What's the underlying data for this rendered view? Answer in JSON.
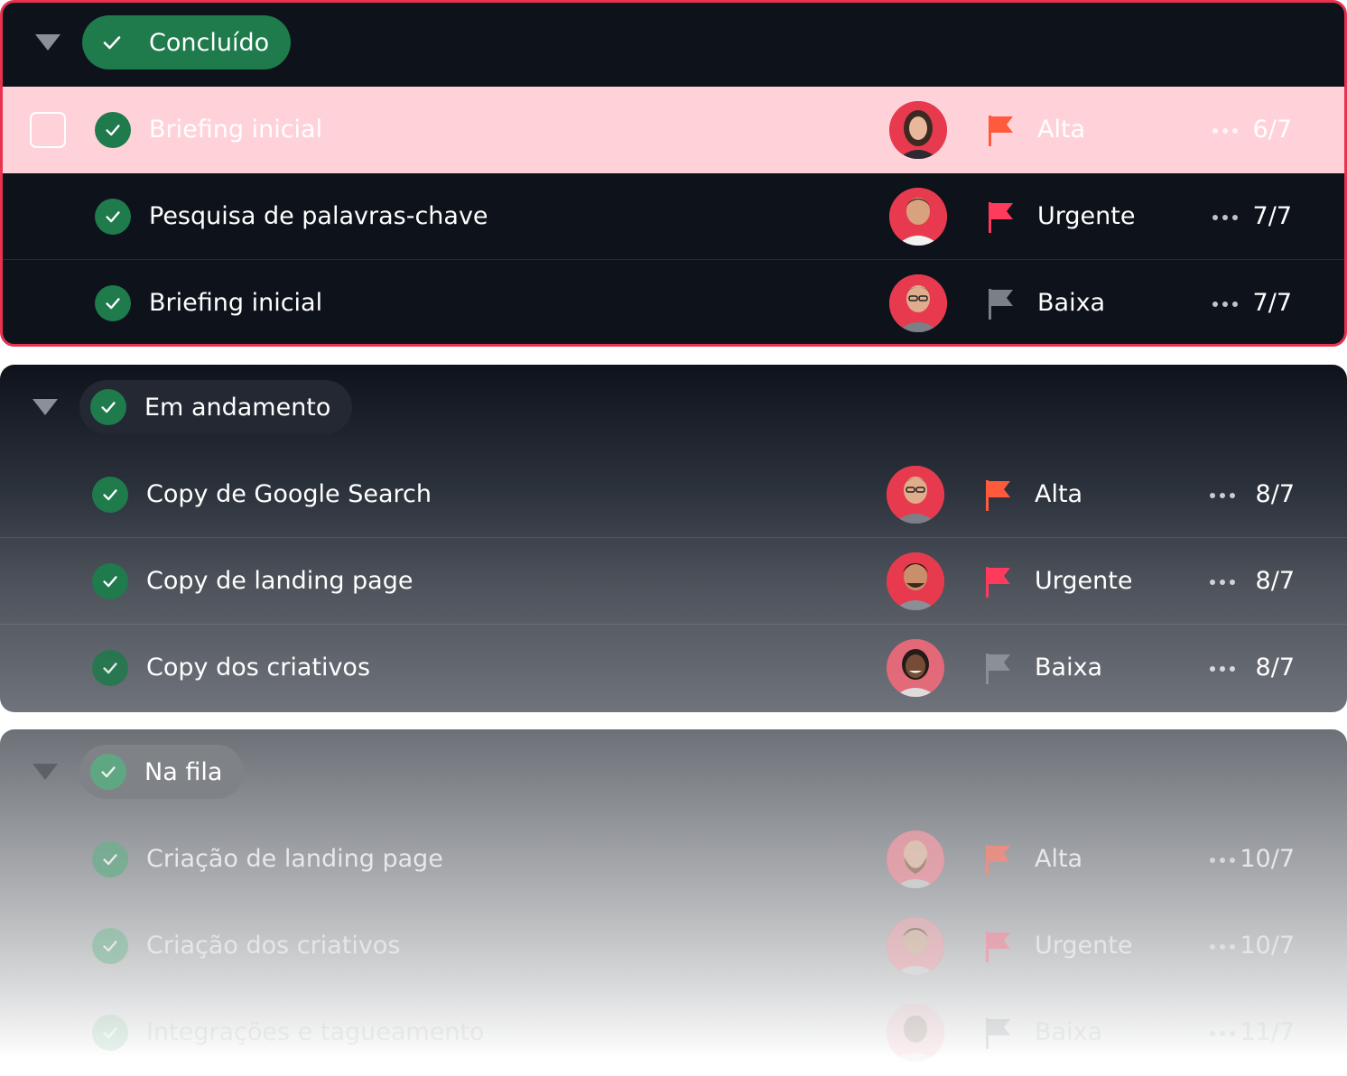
{
  "colors": {
    "accent_red": "#e8324f",
    "done_green": "#1f7a4c",
    "highlight_row": "#ffd2da",
    "dark_bg": "#0e121b",
    "flag_high": "#ff5a3c",
    "flag_urgent": "#ff3a5c",
    "flag_low": "#7b7f87"
  },
  "groups": [
    {
      "label": "Concluído",
      "icon": "check-icon",
      "tasks": [
        {
          "name": "Briefing inicial",
          "priority": "Alta",
          "count": "6/7",
          "flag": "high",
          "highlighted": true
        },
        {
          "name": "Pesquisa de palavras-chave",
          "priority": "Urgente",
          "count": "7/7",
          "flag": "urgent"
        },
        {
          "name": "Briefing inicial",
          "priority": "Baixa",
          "count": "7/7",
          "flag": "low"
        }
      ]
    },
    {
      "label": "Em andamento",
      "icon": "check-icon",
      "tasks": [
        {
          "name": "Copy de Google Search",
          "priority": "Alta",
          "count": "8/7",
          "flag": "high"
        },
        {
          "name": "Copy de landing page",
          "priority": "Urgente",
          "count": "8/7",
          "flag": "urgent"
        },
        {
          "name": "Copy dos criativos",
          "priority": "Baixa",
          "count": "8/7",
          "flag": "low"
        }
      ]
    },
    {
      "label": "Na fila",
      "icon": "check-icon",
      "tasks": [
        {
          "name": "Criação de landing page",
          "priority": "Alta",
          "count": "10/7",
          "flag": "high"
        },
        {
          "name": "Criação dos criativos",
          "priority": "Urgente",
          "count": "10/7",
          "flag": "urgent"
        },
        {
          "name": "Integrações e tagueamento",
          "priority": "Baixa",
          "count": "11/7",
          "flag": "low"
        }
      ]
    }
  ]
}
